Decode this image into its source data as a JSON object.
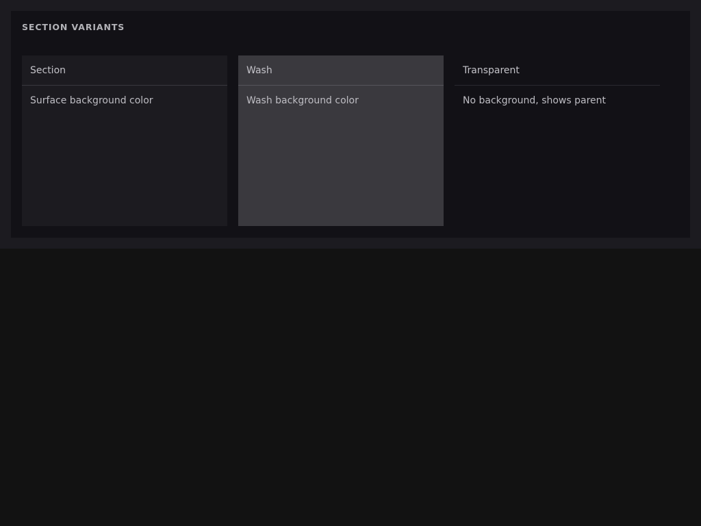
{
  "panel": {
    "title": "SECTION VARIANTS"
  },
  "variants": [
    {
      "title": "Section",
      "description": "Surface background color",
      "background": "#1c1b20"
    },
    {
      "title": "Wash",
      "description": "Wash background color",
      "background": "#3a393e"
    },
    {
      "title": "Transparent",
      "description": "No background, shows parent",
      "background": "transparent"
    }
  ],
  "colors": {
    "page_background": "#121212",
    "outer_surface": "#1c1b20",
    "panel_background": "#121116",
    "text": "#c3c2c8",
    "title_text": "#b3b3b8"
  }
}
